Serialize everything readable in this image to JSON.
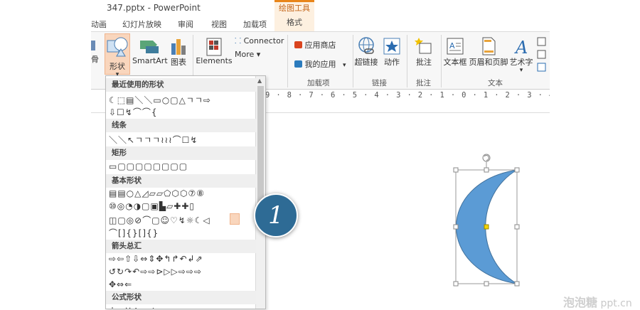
{
  "window": {
    "title": "347.pptx - PowerPoint",
    "context_group": "绘图工具"
  },
  "tabs": [
    "动画",
    "幻灯片放映",
    "审阅",
    "视图",
    "加载项",
    "格式"
  ],
  "ribbon": {
    "shapes_label": "形状",
    "shapes_arrow": "▾",
    "smartart_label": "SmartArt",
    "chart_label": "图表",
    "elements_label": "Elements",
    "connector_label": "Connector",
    "more_label": "More ▾",
    "app_store_label": "应用商店",
    "my_apps_label": "我的应用",
    "my_apps_arrow": "▾",
    "hyperlink_label": "超链接",
    "action_label": "动作",
    "comment_label": "批注",
    "textbox_label": "文本框",
    "header_footer_label": "页眉和页脚",
    "wordart_label": "艺术字",
    "wordart_arrow": "▾",
    "left_cut_label": "骨",
    "groups": {
      "addins": "加载项",
      "links": "链接",
      "comments": "批注",
      "text": "文本"
    }
  },
  "ruler": {
    "text": "9 · 8 · 7 · 6 · 5 · 4 · 3 · 2 · 1 · 0 · 1 · 2 · 3 · 4 · 5 · 6 · 7 · 8 · 9"
  },
  "gallery": {
    "sections": [
      {
        "title": "最近使用的形状",
        "rows": [
          "☾⬚▤＼＼▭○▢△ㄱㄱ⇨",
          "⇩☐↯⌒⌒{"
        ]
      },
      {
        "title": "线条",
        "rows": [
          "＼＼↖ㄱㄱㄱ≀≀≀⌒☐↯"
        ]
      },
      {
        "title": "矩形",
        "rows": [
          "▭▢▢▢▢▢▢▢▢"
        ]
      },
      {
        "title": "基本形状",
        "rows": [
          "▤▤○△◿▱▱⬠⬡⬡⑦⑧",
          "⑩◎◔◑▢▣▙▱✚✚▯",
          "◫▢◎⊘⌒▢☺♡↯☼☾◁",
          "⌒[]{}[]{}"
        ]
      },
      {
        "title": "箭头总汇",
        "rows": [
          "⇨⇦⇧⇩⇔⇕✥↰↱↶↲⇗",
          "↺↻↷↶⇨⇨⊳▷▷⇨⇨⇨",
          "✥⇔⇐"
        ]
      },
      {
        "title": "公式形状",
        "rows": [
          "+−×÷=≠"
        ]
      }
    ]
  },
  "step_badge": "1",
  "watermark": {
    "brand": "泡泡糖",
    "domain": "ppt.cn"
  },
  "colors": {
    "moon_fill": "#5b9bd5",
    "moon_stroke": "#41719c",
    "badge_fill": "#2e6b95",
    "context_tab": "#e8851a"
  }
}
